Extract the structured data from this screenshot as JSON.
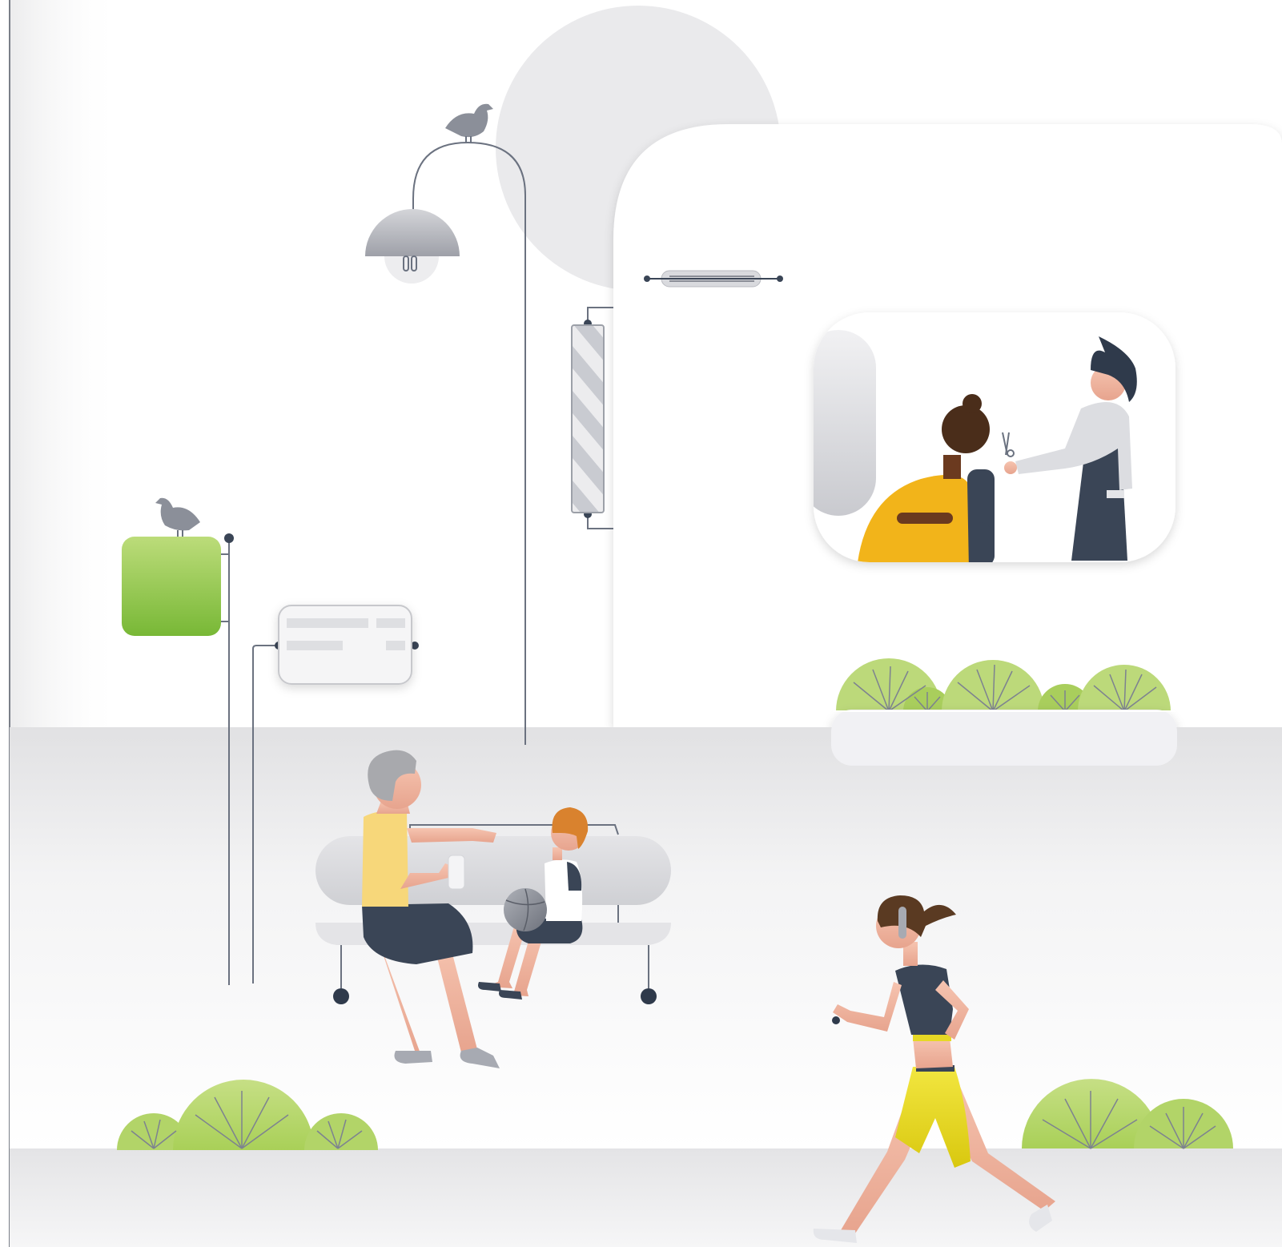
{
  "scene": {
    "description_visible_text": "",
    "colors": {
      "background": "#ffffff",
      "street": "#e9e9ea",
      "sidewalk": "#ededee",
      "building": "#ffffff",
      "accent_green": "#7dbb3c",
      "light_green": "#c3dc84",
      "dark_navy": "#3a4556",
      "mustard": "#f2b41a",
      "yellow": "#ecdc25",
      "skin": "#f2b8a3",
      "grey_pole": "#6b7280",
      "light_grey": "#d9d9dc"
    },
    "icons": [
      "pigeon-icon",
      "street-lamp-icon",
      "barber-pole-icon",
      "green-sign-icon",
      "info-sign-icon",
      "bench-icon",
      "basketball-icon",
      "bush-icon",
      "planter-icon"
    ]
  }
}
